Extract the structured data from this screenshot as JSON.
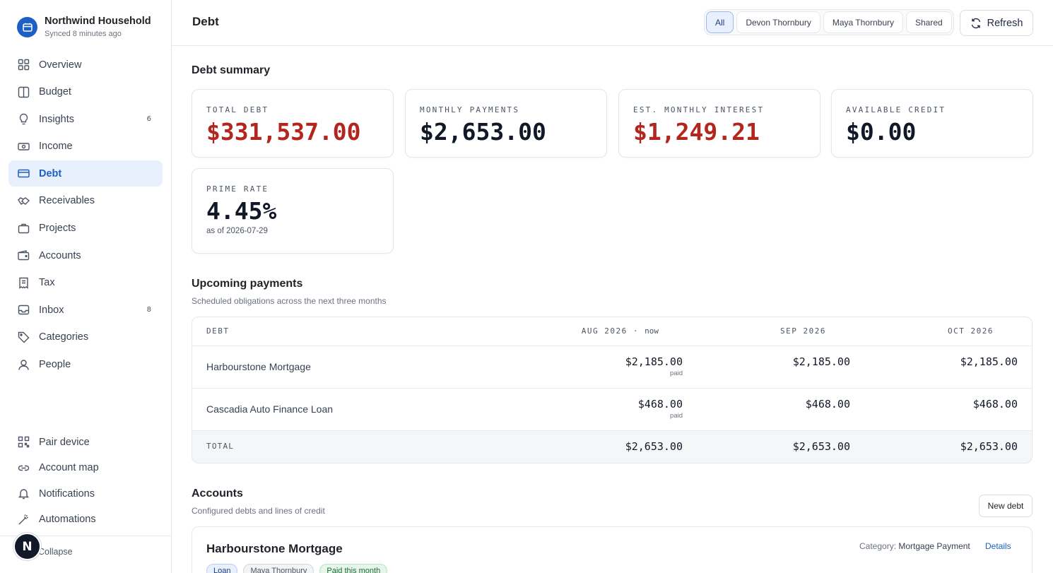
{
  "brand": {
    "title": "Northwind Household",
    "subtitle": "Synced 8 minutes ago"
  },
  "nav": [
    {
      "label": "Overview",
      "icon": "grid-icon",
      "badge": ""
    },
    {
      "label": "Budget",
      "icon": "columns-icon",
      "badge": ""
    },
    {
      "label": "Insights",
      "icon": "lightbulb-icon",
      "badge": "6"
    },
    {
      "label": "Income",
      "icon": "banknote-icon",
      "badge": ""
    },
    {
      "label": "Debt",
      "icon": "credit-card-icon",
      "badge": "",
      "active": true
    },
    {
      "label": "Receivables",
      "icon": "handshake-icon",
      "badge": ""
    },
    {
      "label": "Projects",
      "icon": "briefcase-icon",
      "badge": ""
    },
    {
      "label": "Accounts",
      "icon": "wallet-icon",
      "badge": ""
    },
    {
      "label": "Tax",
      "icon": "receipt-icon",
      "badge": ""
    },
    {
      "label": "Inbox",
      "icon": "inbox-icon",
      "badge": "8"
    },
    {
      "label": "Categories",
      "icon": "tag-icon",
      "badge": ""
    },
    {
      "label": "People",
      "icon": "user-icon",
      "badge": ""
    }
  ],
  "nav_bottom": [
    {
      "label": "Pair device",
      "icon": "qr-code-icon"
    },
    {
      "label": "Account map",
      "icon": "link-icon"
    },
    {
      "label": "Notifications",
      "icon": "bell-icon"
    },
    {
      "label": "Automations",
      "icon": "wand-icon"
    }
  ],
  "collapse_label": "Collapse",
  "avatar_initial": "N",
  "header": {
    "title": "Debt",
    "filters": [
      "All",
      "Devon Thornbury",
      "Maya Thornbury",
      "Shared"
    ],
    "active_filter": "All",
    "refresh_label": "Refresh"
  },
  "summary": {
    "title": "Debt summary",
    "cards": [
      {
        "label": "TOTAL DEBT",
        "value": "$331,537.00",
        "color": "#b3261e"
      },
      {
        "label": "MONTHLY PAYMENTS",
        "value": "$2,653.00",
        "color": "#111827"
      },
      {
        "label": "EST. MONTHLY INTEREST",
        "value": "$1,249.21",
        "color": "#b3261e"
      },
      {
        "label": "AVAILABLE CREDIT",
        "value": "$0.00",
        "color": "#111827"
      }
    ],
    "prime": {
      "label": "PRIME RATE",
      "value": "4.45%",
      "note": "as of 2026-07-29"
    }
  },
  "upcoming": {
    "title": "Upcoming payments",
    "subtitle": "Scheduled obligations across the next three months",
    "col_debt": "DEBT",
    "months": [
      "AUG 2026",
      "SEP 2026",
      "OCT 2026"
    ],
    "now_label": "now",
    "rows": [
      {
        "name": "Harbourstone Mortgage",
        "values": [
          "$2,185.00",
          "$2,185.00",
          "$2,185.00"
        ],
        "paid": "paid"
      },
      {
        "name": "Cascadia Auto Finance Loan",
        "values": [
          "$468.00",
          "$468.00",
          "$468.00"
        ],
        "paid": "paid"
      }
    ],
    "total_label": "TOTAL",
    "totals": [
      "$2,653.00",
      "$2,653.00",
      "$2,653.00"
    ]
  },
  "accounts": {
    "title": "Accounts",
    "subtitle": "Configured debts and lines of credit",
    "new_label": "New debt",
    "items": [
      {
        "name": "Harbourstone Mortgage",
        "category_prefix": "Category:",
        "category": "Mortgage Payment",
        "details_label": "Details",
        "chips": [
          "Loan",
          "Maya Thornbury",
          "Paid this month"
        ]
      }
    ]
  }
}
